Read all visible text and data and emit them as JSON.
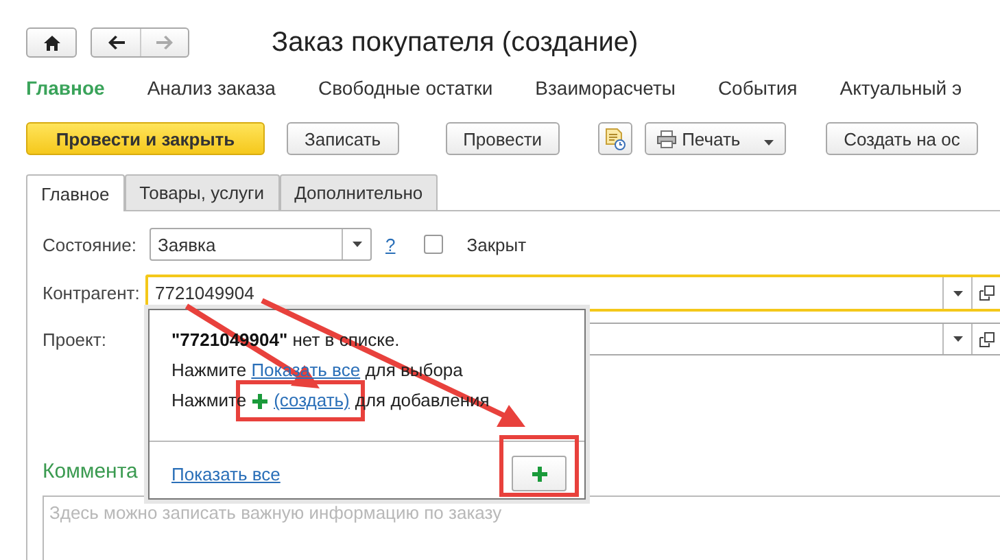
{
  "window": {
    "title": "Заказ покупателя (создание)"
  },
  "nav": [
    {
      "label": "Главное",
      "selected": true
    },
    {
      "label": "Анализ заказа",
      "selected": false
    },
    {
      "label": "Свободные остатки",
      "selected": false
    },
    {
      "label": "Взаиморасчеты",
      "selected": false
    },
    {
      "label": "События",
      "selected": false
    },
    {
      "label": "Актуальный э",
      "selected": false
    }
  ],
  "toolbar": [
    {
      "kind": "primary",
      "label": "Провести и закрыть"
    },
    {
      "kind": "button",
      "label": "Записать"
    },
    {
      "kind": "button",
      "label": "Провести"
    },
    {
      "kind": "icon"
    },
    {
      "kind": "menu",
      "label": "Печать"
    },
    {
      "kind": "button",
      "label": "Создать на ос"
    }
  ],
  "tabs": [
    {
      "label": "Главное",
      "selected": true
    },
    {
      "label": "Товары, услуги",
      "selected": false
    },
    {
      "label": "Дополнительно",
      "selected": false
    }
  ],
  "state": {
    "label": "Состояние:",
    "value": "Заявка",
    "help": "?",
    "closed_label": "Закрыт",
    "closed": false
  },
  "counterparty": {
    "label": "Контрагент:",
    "value": "7721049904"
  },
  "project": {
    "label": "Проект:"
  },
  "popup": {
    "message": "**\"7721049904\"** нет в списке.",
    "line2": {
      "before": "Нажмите",
      "link": "Показать все",
      "after": "для выбора"
    },
    "line3": {
      "before": "Нажмите",
      "link": "(создать)",
      "after": "для добавления"
    },
    "footer_link": "Показать все"
  },
  "comment": {
    "heading": "Коммента",
    "placeholder": "Здесь можно записать важную информацию по заказу"
  }
}
